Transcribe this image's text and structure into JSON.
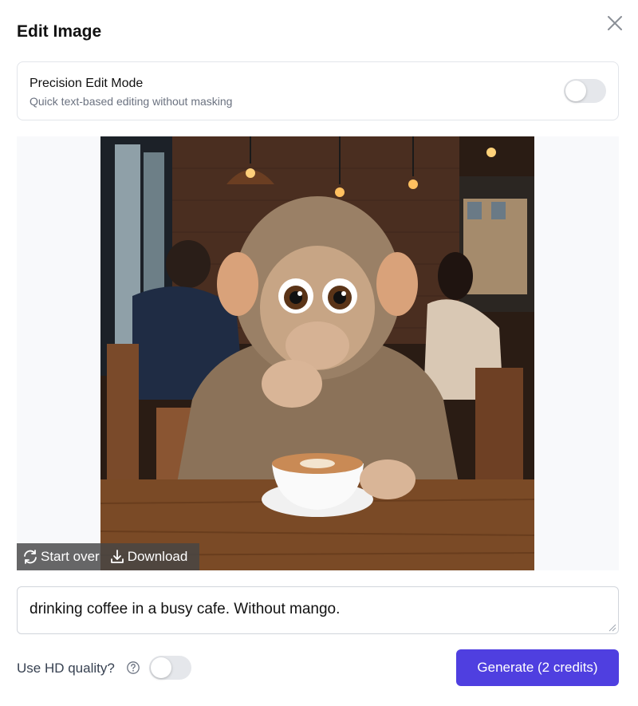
{
  "dialog": {
    "title": "Edit Image",
    "close_icon": "close-icon"
  },
  "precision_mode": {
    "title": "Precision Edit Mode",
    "subtitle": "Quick text-based editing without masking",
    "enabled": false
  },
  "image_toolbar": {
    "start_over_label": "Start over",
    "start_over_icon": "refresh-icon",
    "download_label": "Download",
    "download_icon": "download-icon"
  },
  "prompt": {
    "value": "drinking coffee in a busy cafe. Without mango."
  },
  "footer": {
    "hd_label": "Use HD quality?",
    "hd_enabled": false,
    "help_icon": "help-circle-icon",
    "generate_label": "Generate (2 credits)",
    "accent_color": "#4f3fe0"
  }
}
